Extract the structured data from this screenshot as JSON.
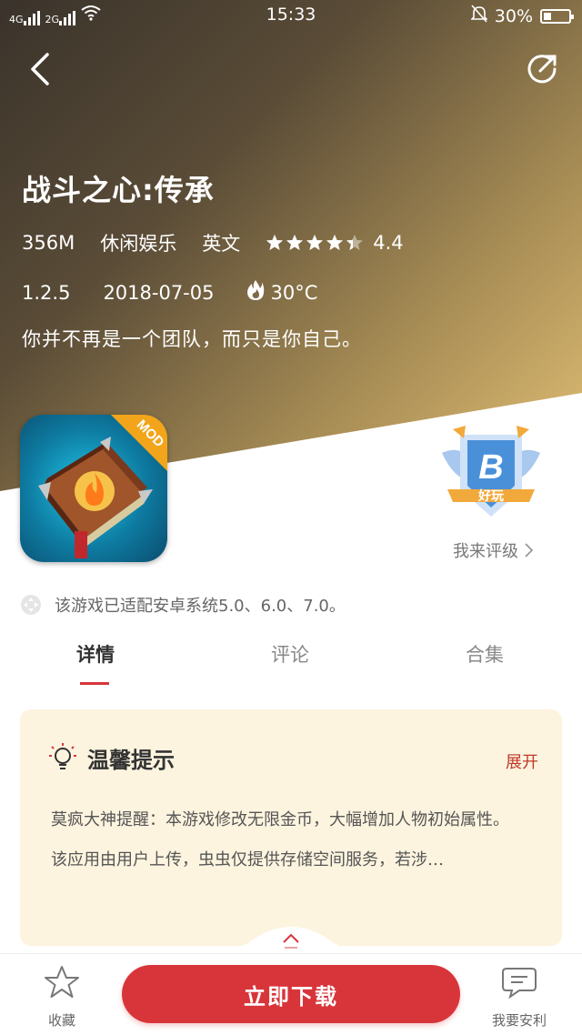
{
  "status_bar": {
    "signal1": "4G",
    "signal2": "2G",
    "time": "15:33",
    "battery": "30%",
    "battery_level": 0.3
  },
  "app": {
    "title": "战斗之心:传承",
    "size": "356M",
    "category": "休闲娱乐",
    "language": "英文",
    "rating": "4.4",
    "rating_value": 4.4,
    "version": "1.2.5",
    "date": "2018-07-05",
    "heat": "30°C",
    "tagline": "你并不再是一个团队，而只是你自己。",
    "icon_badge": "MOD"
  },
  "grade_badge": {
    "letter": "B",
    "label": "好玩",
    "link": "我来评级"
  },
  "compat_text": "该游戏已适配安卓系统5.0、6.0、7.0。",
  "tabs": [
    {
      "label": "详情"
    },
    {
      "label": "评论"
    },
    {
      "label": "合集"
    }
  ],
  "tip": {
    "title": "温馨提示",
    "expand": "展开",
    "line1": "莫疯大神提醒：本游戏修改无限金币，大幅增加人物初始属性。",
    "line2": "该应用由用户上传，虫虫仅提供存储空间服务，若涉…"
  },
  "bottom": {
    "fav": "收藏",
    "download": "立即下载",
    "report": "我要安利"
  },
  "colors": {
    "accent": "#d8353b",
    "tip_bg": "#fdf4df",
    "badge_blue": "#4a90d9",
    "badge_gold": "#f2a93b"
  }
}
